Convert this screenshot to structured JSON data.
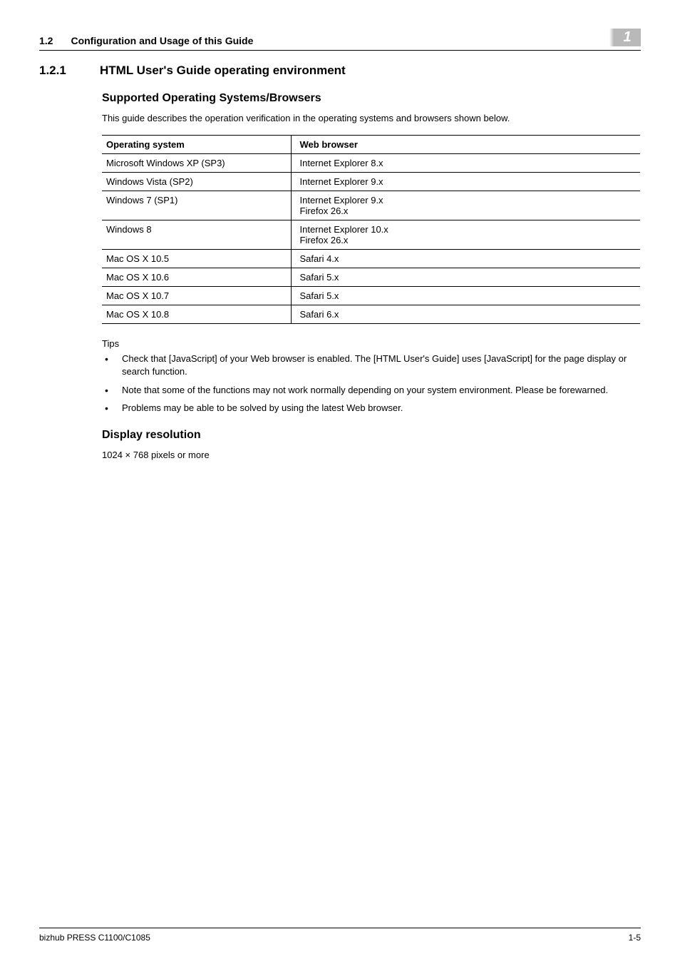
{
  "header": {
    "section_number": "1.2",
    "section_title": "Configuration and Usage of this Guide",
    "chapter_number": "1"
  },
  "section": {
    "number": "1.2.1",
    "title": "HTML User's Guide operating environment"
  },
  "sub1": {
    "heading": "Supported Operating Systems/Browsers",
    "intro": "This guide describes the operation verification in the operating systems and browsers shown below."
  },
  "table": {
    "head_os": "Operating system",
    "head_browser": "Web browser",
    "rows": [
      {
        "os": "Microsoft Windows XP (SP3)",
        "browser": "Internet Explorer 8.x"
      },
      {
        "os": "Windows Vista (SP2)",
        "browser": "Internet Explorer 9.x"
      },
      {
        "os": "Windows 7 (SP1)",
        "browser": "Internet Explorer 9.x\nFirefox 26.x"
      },
      {
        "os": "Windows 8",
        "browser": "Internet Explorer 10.x\nFirefox 26.x"
      },
      {
        "os": "Mac OS X 10.5",
        "browser": "Safari 4.x"
      },
      {
        "os": "Mac OS X 10.6",
        "browser": "Safari 5.x"
      },
      {
        "os": "Mac OS X 10.7",
        "browser": "Safari 5.x"
      },
      {
        "os": "Mac OS X 10.8",
        "browser": "Safari 6.x"
      }
    ]
  },
  "tips_label": "Tips",
  "tips": [
    "Check that [JavaScript] of your Web browser is enabled. The [HTML User's Guide] uses [JavaScript] for the page display or search function.",
    "Note that some of the functions may not work normally depending on your system environment. Please be forewarned.",
    "Problems may be able to be solved by using the latest Web browser."
  ],
  "sub2": {
    "heading": "Display resolution",
    "text": "1024 × 768 pixels or more"
  },
  "footer": {
    "left": "bizhub PRESS C1100/C1085",
    "right": "1-5"
  }
}
